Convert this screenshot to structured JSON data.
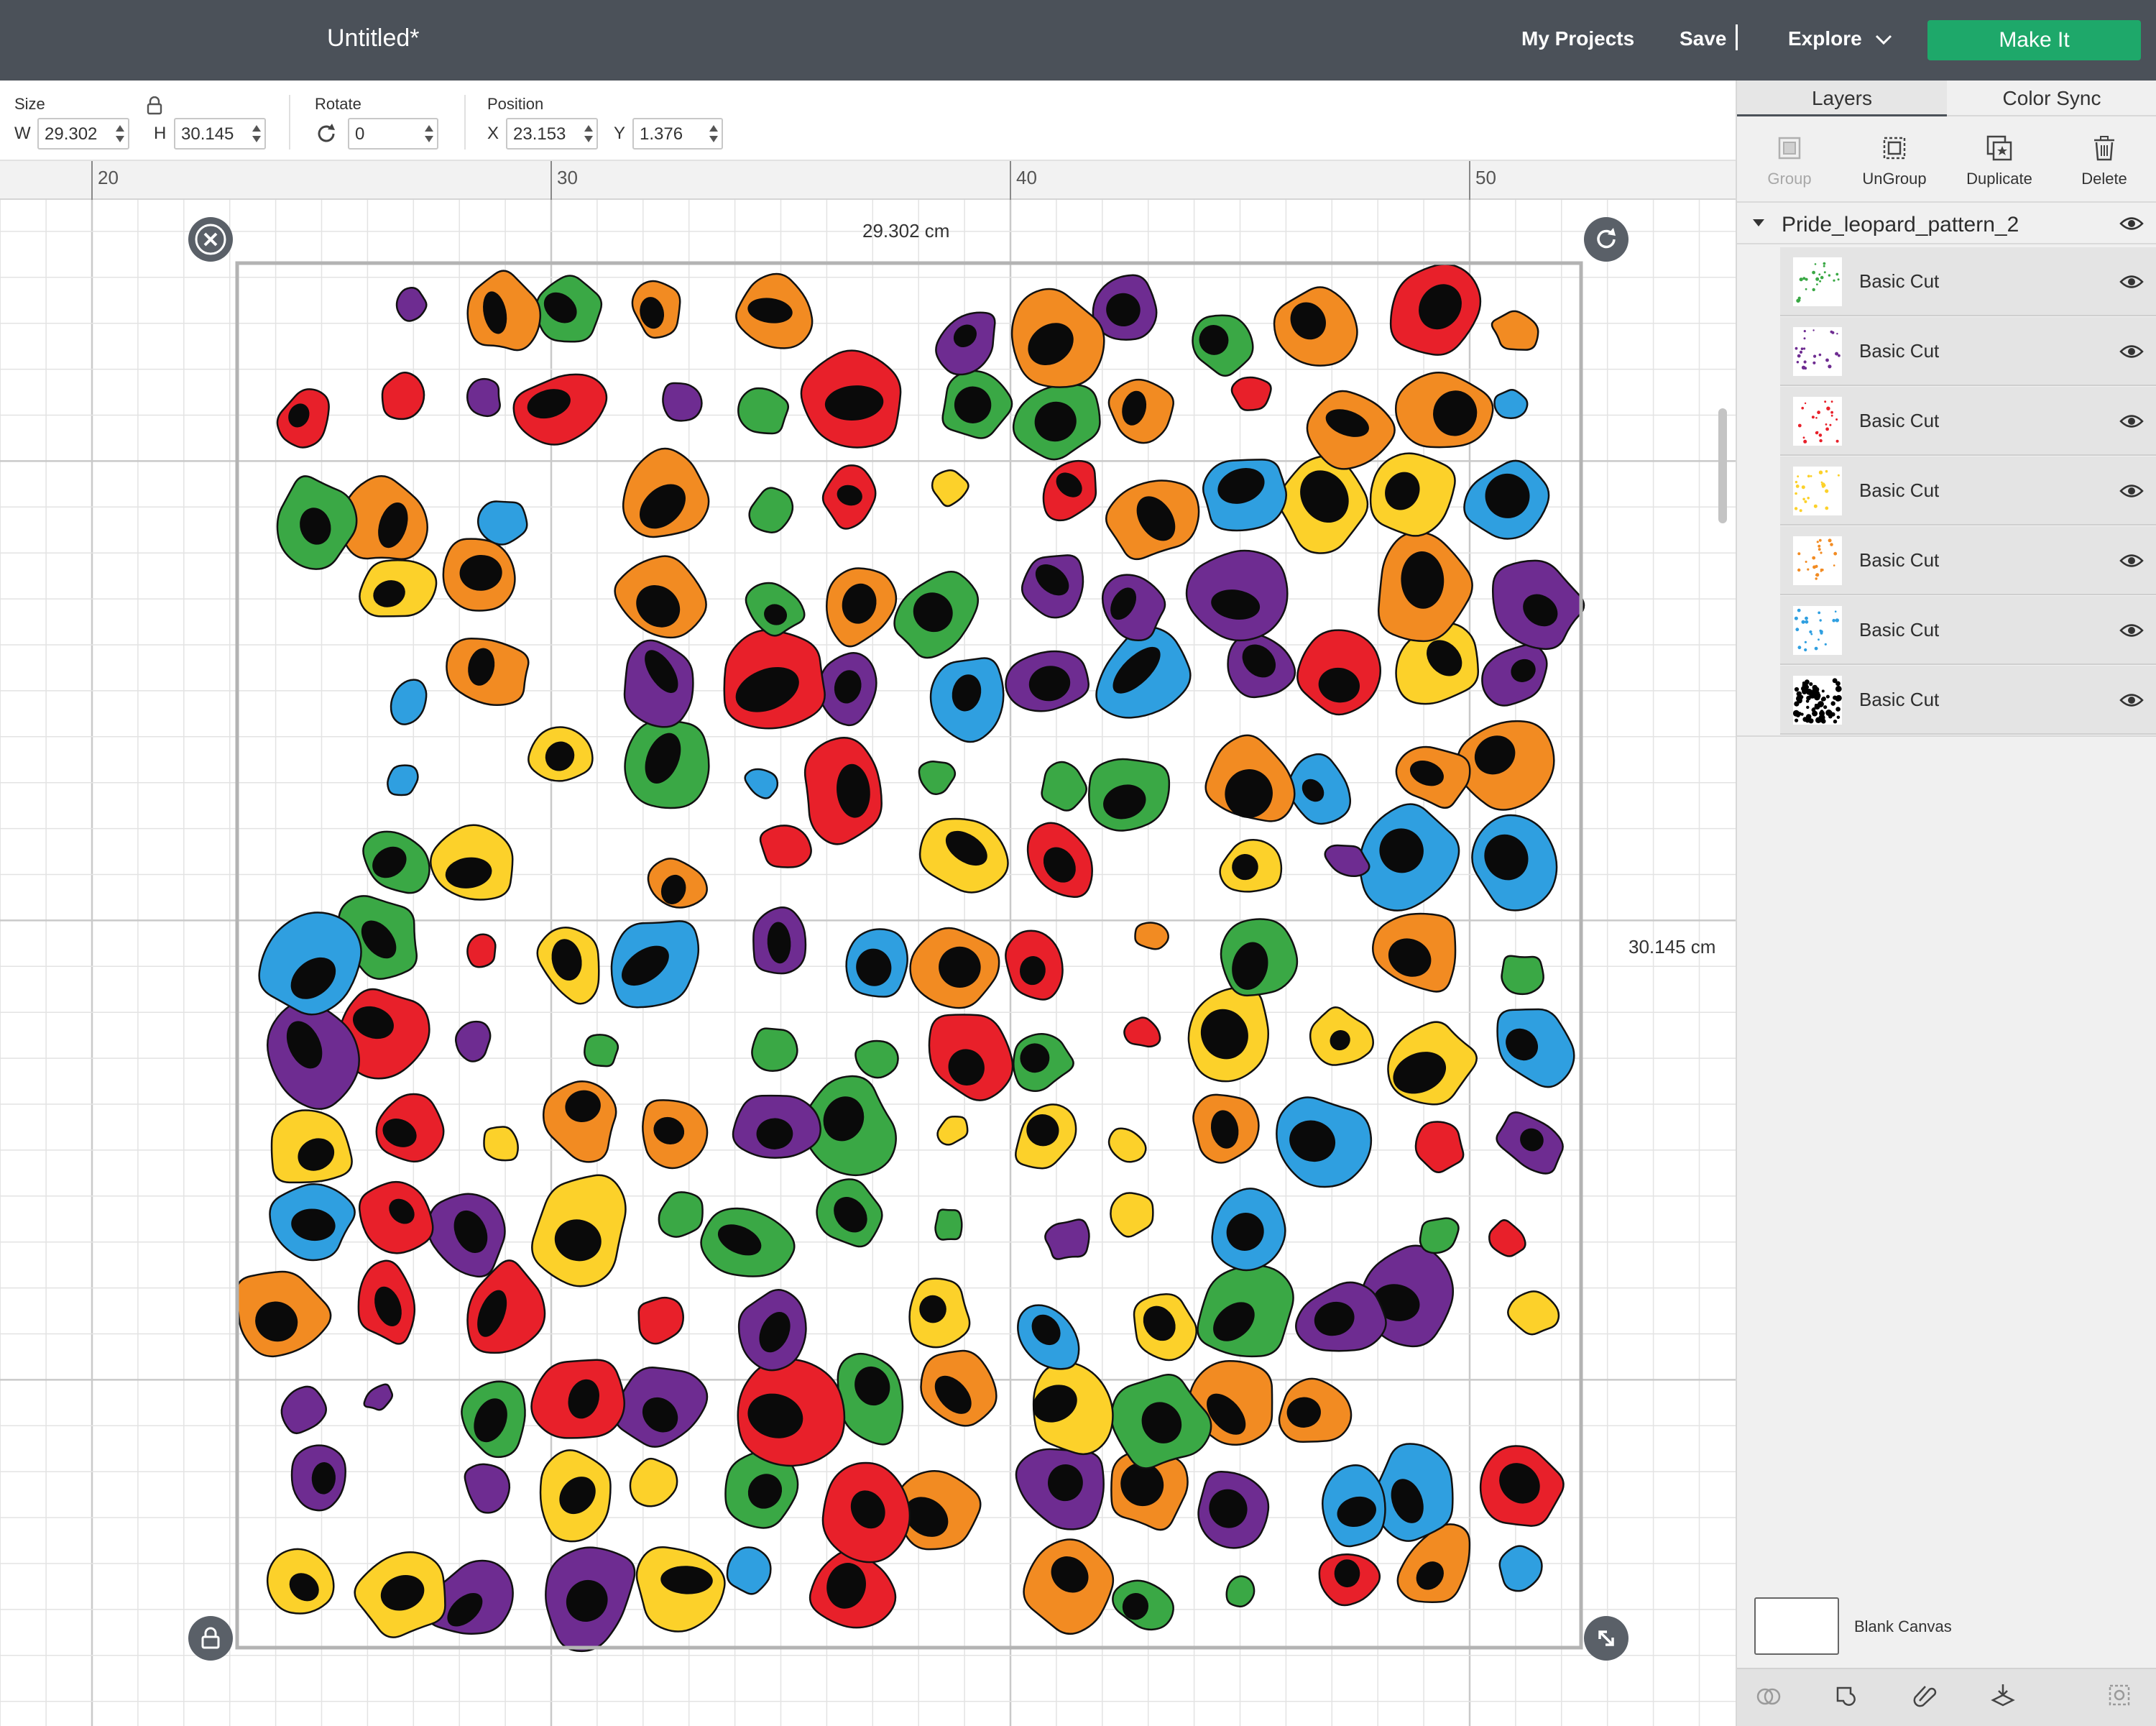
{
  "app": {
    "title": "Untitled*"
  },
  "topbar": {
    "my_projects": "My Projects",
    "save": "Save",
    "separator": "|",
    "explore": "Explore",
    "make_it": "Make It"
  },
  "toolbar": {
    "size_label": "Size",
    "w_label": "W",
    "w_value": "29.302",
    "h_label": "H",
    "h_value": "30.145",
    "rotate_label": "Rotate",
    "rotate_value": "0",
    "position_label": "Position",
    "x_label": "X",
    "x_value": "23.153",
    "y_label": "Y",
    "y_value": "1.376"
  },
  "ruler": {
    "marks": [
      "20",
      "30",
      "40",
      "50"
    ]
  },
  "canvas": {
    "width_label": "29.302 cm",
    "height_label": "30.145 cm",
    "grid_color": "#e3e3e3",
    "major_grid_color": "#c9c9c9",
    "pattern_colors": [
      "#e8202a",
      "#f28b22",
      "#fcd12a",
      "#3aa845",
      "#2f9fe0",
      "#6e2c91"
    ]
  },
  "panel": {
    "tabs": [
      "Layers",
      "Color Sync"
    ],
    "actions": [
      {
        "label": "Group",
        "icon": "group-icon",
        "enabled": false
      },
      {
        "label": "UnGroup",
        "icon": "ungroup-icon",
        "enabled": true
      },
      {
        "label": "Duplicate",
        "icon": "duplicate-icon",
        "enabled": true
      },
      {
        "label": "Delete",
        "icon": "trash-icon",
        "enabled": true
      }
    ],
    "group_name": "Pride_leopard_pattern_2",
    "layers": [
      {
        "name": "Basic Cut",
        "color": "#3aa845"
      },
      {
        "name": "Basic Cut",
        "color": "#6e2c91"
      },
      {
        "name": "Basic Cut",
        "color": "#e8202a"
      },
      {
        "name": "Basic Cut",
        "color": "#fcd12a"
      },
      {
        "name": "Basic Cut",
        "color": "#f28b22"
      },
      {
        "name": "Basic Cut",
        "color": "#2f9fe0"
      },
      {
        "name": "Basic Cut",
        "color": "#000000"
      }
    ],
    "blank_canvas": "Blank Canvas"
  }
}
